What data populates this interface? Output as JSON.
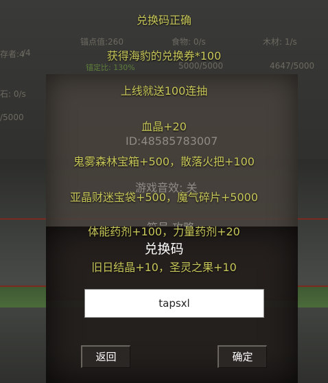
{
  "hud": {
    "anchor": "锚点值:260",
    "food": "食物: 0/s",
    "wood": "木材: 1/s",
    "survivors_partial": "存者:4",
    "survivors_cap_partial": "/4",
    "anchor_ratio": "锚定比: 130%",
    "food_stock": "5000/5000",
    "wood_stock": "4647/5000",
    "stone_partial": "石: 0/s",
    "stone_stock_partial": "/5000"
  },
  "background_panel": {
    "id_line": "ID:48585783007",
    "sound_line": "游戏音效: 关",
    "partial_line": "符号 攻略"
  },
  "toast": {
    "line1": "兑换码正确",
    "line2": "获得海豹的兑换券*100",
    "line3": "上线就送100连抽",
    "line4": "血晶+20",
    "line5": "鬼雾森林宝箱+500，散落火把+100",
    "line6": "亚晶财迷宝袋+500，魔气碎片+5000",
    "line7": "体能药剂+100，力量药剂+20",
    "line8": "旧日结晶+10，圣灵之果+10"
  },
  "dialog": {
    "title": "兑换码",
    "code_value": "tapsxl",
    "back_label": "返回",
    "confirm_label": "确定"
  },
  "colors": {
    "reward_text": "#c9c85a",
    "accent_green": "#5f7f3c",
    "panel": "#221e1c"
  }
}
